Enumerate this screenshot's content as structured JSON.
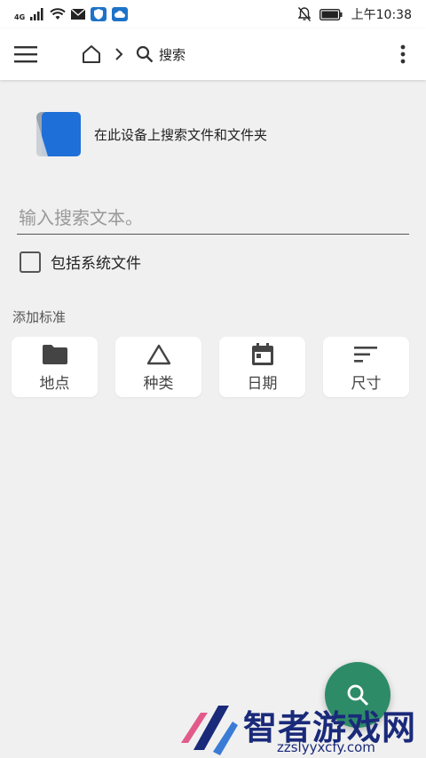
{
  "status_bar": {
    "network": "4G",
    "time": "上午10:38",
    "icons": [
      "signal-icon",
      "wifi-icon",
      "mail-icon",
      "shield-app-icon",
      "cloud-app-icon",
      "mute-bell-icon",
      "battery-icon"
    ]
  },
  "app_bar": {
    "breadcrumb_label": "搜索",
    "icons": [
      "menu-icon",
      "home-icon",
      "chevron-right-icon",
      "search-icon",
      "more-vert-icon"
    ]
  },
  "scope": {
    "text": "在此设备上搜索文件和文件夹"
  },
  "search": {
    "placeholder": "输入搜索文本。"
  },
  "include_system": {
    "label": "包括系统文件",
    "checked": false
  },
  "criteria": {
    "section_label": "添加标准",
    "items": [
      {
        "label": "地点",
        "icon": "folder-icon"
      },
      {
        "label": "种类",
        "icon": "triangle-icon"
      },
      {
        "label": "日期",
        "icon": "calendar-icon"
      },
      {
        "label": "尺寸",
        "icon": "sort-lines-icon"
      }
    ]
  },
  "fab": {
    "icon": "search-icon"
  },
  "watermark": {
    "title": "智者游戏网",
    "url": "zzslyyxcfy.com"
  },
  "colors": {
    "accent": "#2e8b67",
    "background": "#f0f0f0",
    "watermark": "#1a2a7a"
  }
}
